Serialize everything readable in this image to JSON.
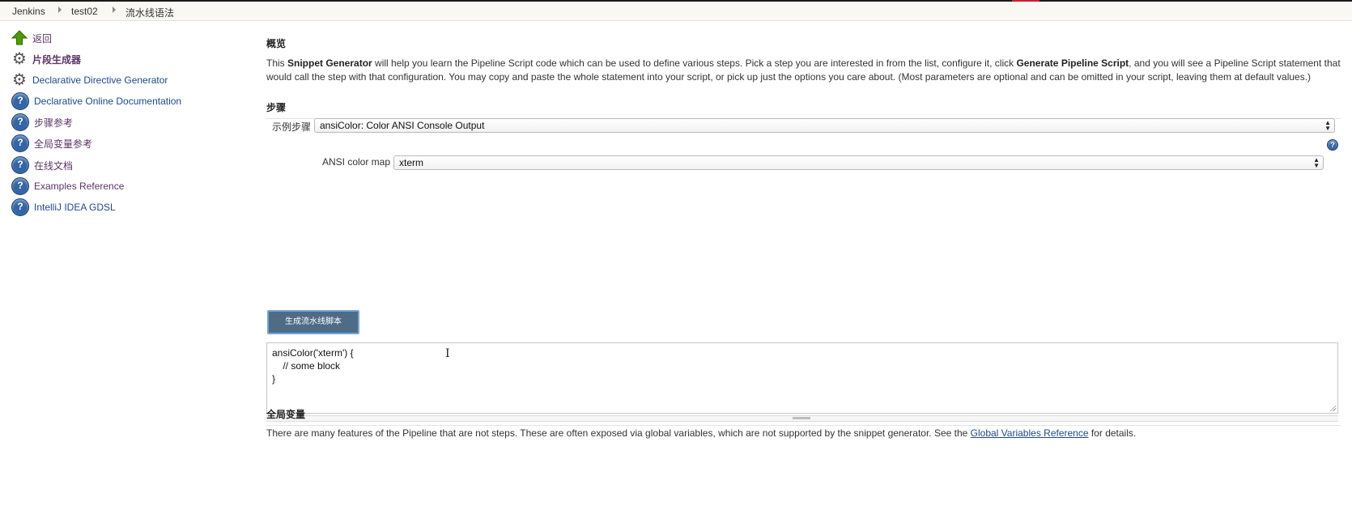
{
  "breadcrumbs": [
    "Jenkins",
    "test02",
    "流水线语法"
  ],
  "sidebar": {
    "items": [
      {
        "label": "返回",
        "icon": "up-arrow-icon"
      },
      {
        "label": "片段生成器",
        "icon": "gear-icon"
      },
      {
        "label": "Declarative Directive Generator",
        "icon": "gear-icon"
      },
      {
        "label": "Declarative Online Documentation",
        "icon": "help-icon"
      },
      {
        "label": "步骤参考",
        "icon": "help-icon"
      },
      {
        "label": "全局变量参考",
        "icon": "help-icon"
      },
      {
        "label": "在线文档",
        "icon": "help-icon"
      },
      {
        "label": "Examples Reference",
        "icon": "help-icon"
      },
      {
        "label": "IntelliJ IDEA GDSL",
        "icon": "help-icon"
      }
    ]
  },
  "overview": {
    "heading": "概览",
    "text_1": "This ",
    "bold_1": "Snippet Generator",
    "text_2": " will help you learn the Pipeline Script code which can be used to define various steps. Pick a step you are interested in from the list, configure it, click ",
    "bold_2": "Generate Pipeline Script",
    "text_3": ", and you will see a Pipeline Script statement that would call the step with that configuration. You may copy and paste the whole statement into your script, or pick up just the options you care about. (Most parameters are optional and can be omitted in your script, leaving them at default values.)"
  },
  "steps": {
    "heading": "步骤",
    "sample_step_label": "示例步骤",
    "sample_step_value": "ansiColor: Color ANSI Console Output",
    "ansi_color_map_label": "ANSI color map",
    "ansi_color_map_value": "xterm"
  },
  "generate_button": "生成流水线脚本",
  "script_output": "ansiColor('xterm') {\n    // some block\n}",
  "global_vars": {
    "heading": "全局变量",
    "text_before": "There are many features of the Pipeline that are not steps. These are often exposed via global variables, which are not supported by the snippet generator. See the ",
    "link": "Global Variables Reference",
    "text_after": " for details."
  },
  "colors": {
    "link": "#204a87",
    "visited": "#5c3566",
    "button": "#4f6b86",
    "breadcrumb_bg": "#f9f8f3"
  }
}
